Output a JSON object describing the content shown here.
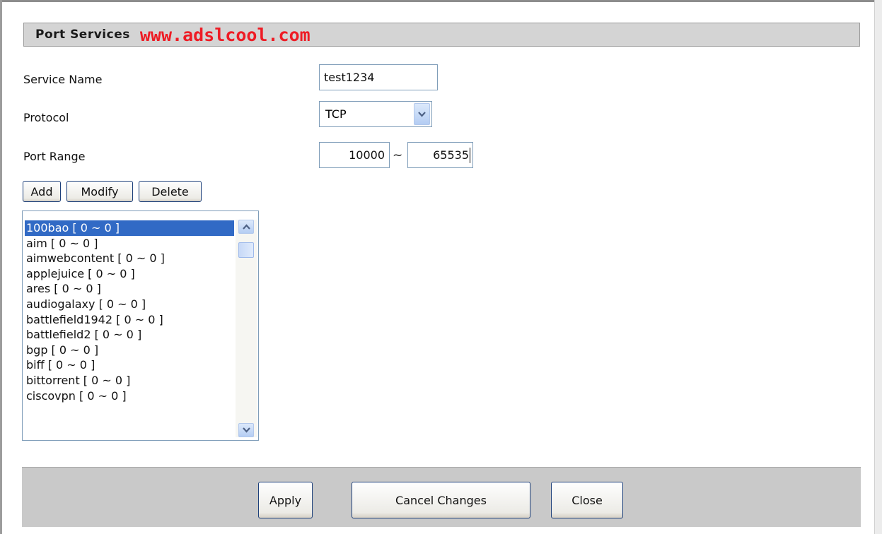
{
  "header": {
    "title": "Port Services",
    "brand": "www.adslcool.com"
  },
  "form": {
    "service_name_label": "Service Name",
    "service_name_value": "test1234",
    "protocol_label": "Protocol",
    "protocol_value": "TCP",
    "port_range_label": "Port Range",
    "port_start": "10000",
    "port_separator": "~",
    "port_end": "65535"
  },
  "actions": {
    "add": "Add",
    "modify": "Modify",
    "delete": "Delete"
  },
  "services": [
    "100bao [ 0 ~ 0 ]",
    "aim [ 0 ~ 0 ]",
    "aimwebcontent [ 0 ~ 0 ]",
    "applejuice [ 0 ~ 0 ]",
    "ares [ 0 ~ 0 ]",
    "audiogalaxy [ 0 ~ 0 ]",
    "battlefield1942 [ 0 ~ 0 ]",
    "battlefield2 [ 0 ~ 0 ]",
    "bgp [ 0 ~ 0 ]",
    "biff [ 0 ~ 0 ]",
    "bittorrent [ 0 ~ 0 ]",
    "ciscovpn [ 0 ~ 0 ]"
  ],
  "selected_service_index": 0,
  "footer": {
    "apply": "Apply",
    "cancel": "Cancel Changes",
    "close": "Close"
  },
  "colors": {
    "brand": "#ee1c25",
    "selection": "#316ac5",
    "header_bg": "#d4d4d4",
    "footer_bg": "#c9c9c9"
  },
  "icons": {
    "dropdown": "chevron-down-icon",
    "scroll_up": "chevron-up-icon",
    "scroll_down": "chevron-down-icon"
  }
}
